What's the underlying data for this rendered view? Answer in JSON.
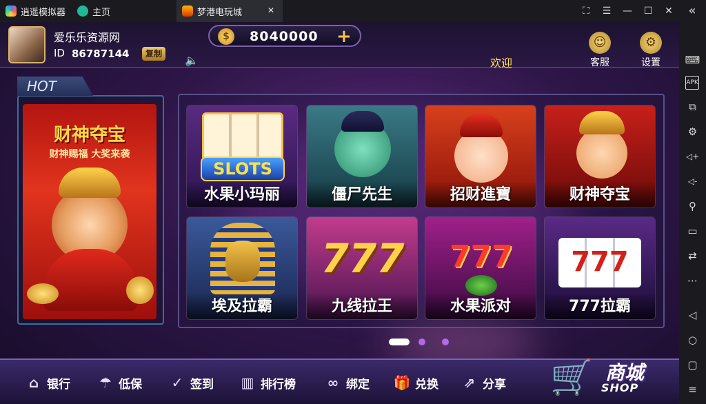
{
  "titlebar": {
    "app_name": "逍遥模拟器",
    "tab_home": "主页",
    "tab_game": "梦港电玩城",
    "close_tab": "✕",
    "collapse": "«",
    "btn_capture": "⛶",
    "btn_menu": "☰",
    "btn_min": "—",
    "btn_max": "☐",
    "btn_close": "✕"
  },
  "sidebar": {
    "items": [
      "⌨",
      "APK",
      "⧉",
      "⚙",
      "◁+",
      "◁-",
      "⚲",
      "▭",
      "⇄",
      "⋯",
      "◁",
      "○",
      "▢",
      "≡"
    ]
  },
  "user": {
    "nickname": "爱乐乐资源网",
    "id_label": "ID",
    "id_value": "86787144",
    "copy_label": "复制"
  },
  "coins": {
    "icon": "$",
    "amount": "8040000",
    "plus": "+"
  },
  "speaker_icon": "🔈",
  "welcome": "欢迎",
  "top_icons": [
    {
      "label": "客服",
      "icon": "☺"
    },
    {
      "label": "设置",
      "icon": "⚙"
    }
  ],
  "hot": {
    "tab_label": "HOT",
    "title": "财神夺宝",
    "subtitle": "财神赐福 大奖来袭"
  },
  "games": [
    {
      "label": "水果小玛丽"
    },
    {
      "label": "僵尸先生"
    },
    {
      "label": "招财進寶"
    },
    {
      "label": "财神夺宝"
    },
    {
      "label": "埃及拉霸"
    },
    {
      "label": "九线拉王"
    },
    {
      "label": "水果派对"
    },
    {
      "label": "777拉霸"
    }
  ],
  "tile_texts": {
    "slots": "SLOTS",
    "seven1": "777",
    "seven2": "777",
    "seven3": "777"
  },
  "pager": {
    "pages": 3,
    "active": 1
  },
  "bottom_nav": [
    {
      "label": "银行",
      "icon": "⌂"
    },
    {
      "label": "低保",
      "icon": "☂"
    },
    {
      "label": "签到",
      "icon": "✓"
    },
    {
      "label": "排行榜",
      "icon": "▥"
    },
    {
      "label": "绑定",
      "icon": "∞"
    },
    {
      "label": "兑换",
      "icon": "🎁"
    },
    {
      "label": "分享",
      "icon": "⇗"
    }
  ],
  "shop": {
    "label_cn": "商城",
    "label_en": "SHOP",
    "icon": "🛒"
  },
  "colors": {
    "accent_gold": "#ffe14a",
    "panel_border": "#5a4f86",
    "hot_red": "#e1341e"
  }
}
